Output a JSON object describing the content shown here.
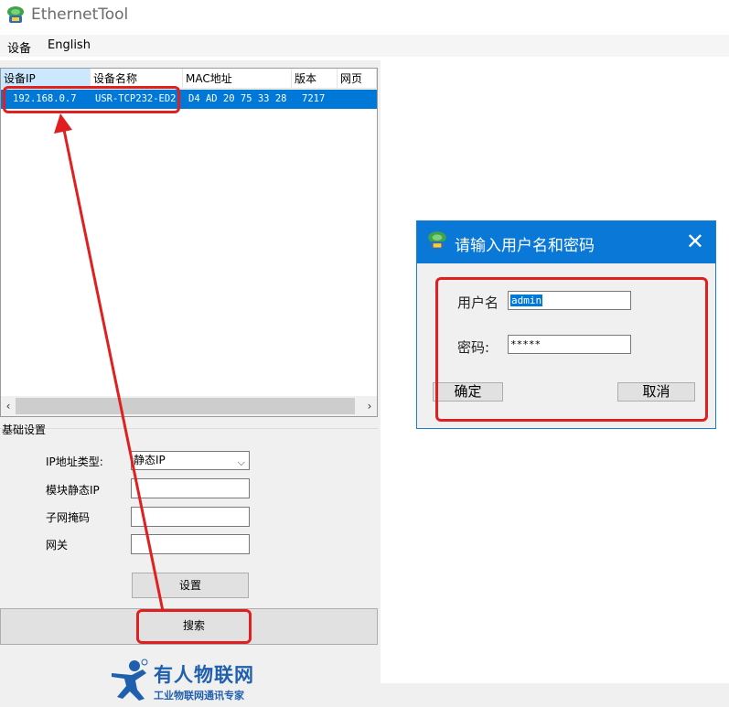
{
  "window": {
    "title": "EthernetTool"
  },
  "menu": {
    "items": [
      "设备",
      "English"
    ]
  },
  "device_list": {
    "columns": [
      "设备IP",
      "设备名称",
      "MAC地址",
      "版本",
      "网页"
    ],
    "rows": [
      {
        "ip": "192.168.0.7",
        "name": "USR-TCP232-ED2",
        "mac": "D4 AD 20 75 33 28",
        "version": "7217",
        "web": ""
      }
    ],
    "scroll_left": "‹",
    "scroll_right": "›"
  },
  "basic_settings": {
    "group_title": "基础设置",
    "ip_type_label": "IP地址类型:",
    "ip_type_value": "静态IP",
    "static_ip_label": "模块静态IP",
    "static_ip_value": "",
    "subnet_label": "子网掩码",
    "subnet_value": "",
    "gateway_label": "网关",
    "gateway_value": "",
    "set_button": "设置"
  },
  "search_button": "搜索",
  "logo": {
    "name": "有人物联网",
    "tagline": "工业物联网通讯专家"
  },
  "login_dialog": {
    "title": "请输入用户名和密码",
    "username_label": "用户名",
    "username_value": "admin",
    "password_label": "密码:",
    "password_value": "*****",
    "ok_button": "确定",
    "cancel_button": "取消",
    "close_glyph": "✕"
  },
  "colors": {
    "selection_blue": "#0078d7",
    "annotation_red": "#e02020",
    "logo_blue": "#1f5fad"
  }
}
